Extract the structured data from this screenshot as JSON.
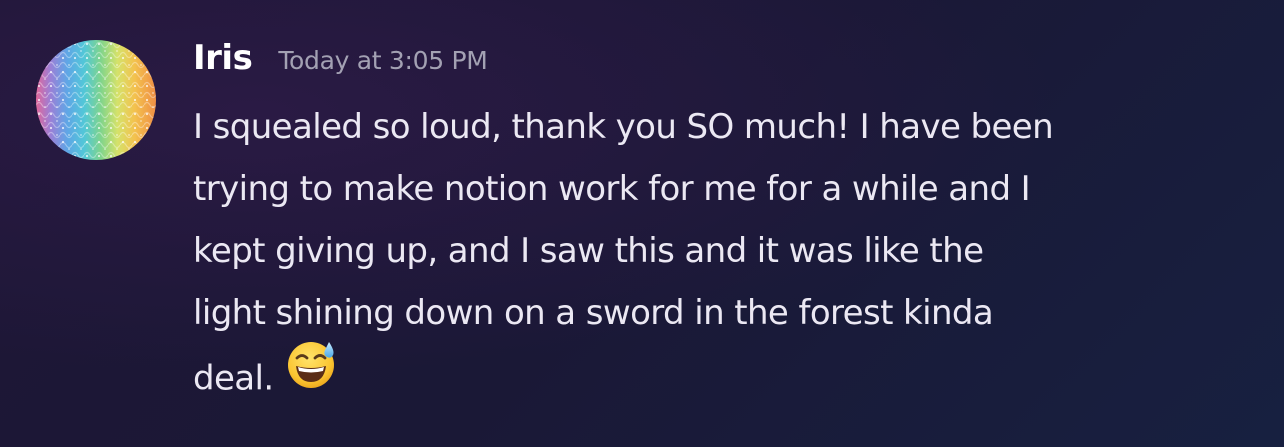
{
  "message": {
    "author": "Iris",
    "timestamp": "Today at 3:05 PM",
    "lines": [
      "I squealed so loud, thank you SO much! I have been",
      "trying to make notion work for me for a while and I",
      "kept giving up, and I saw this and it was like the",
      "light shining down on a sword in the forest kinda",
      "deal."
    ],
    "emoji": "grinning-face-with-sweat-icon"
  },
  "colors": {
    "background": "#1d1838",
    "username": "#ffffff",
    "timestamp": "#a3a1b3",
    "text": "#ebe8f3"
  }
}
